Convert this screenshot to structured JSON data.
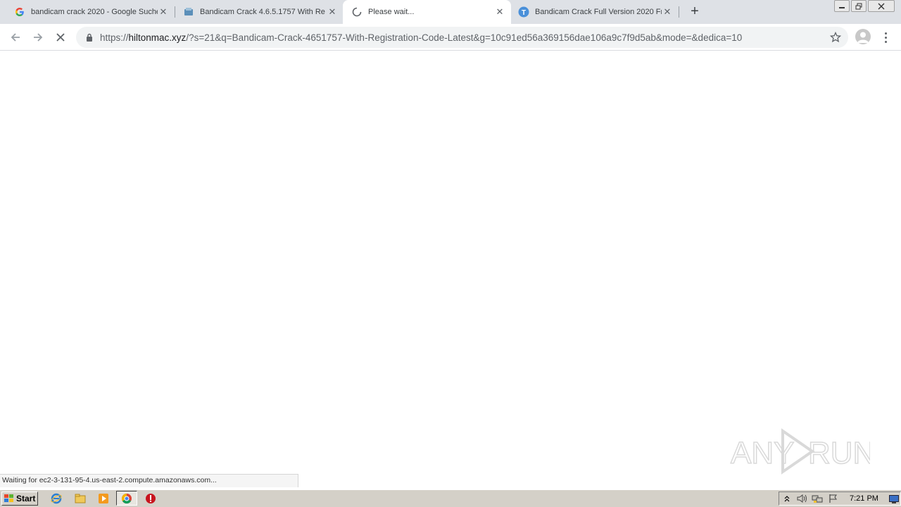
{
  "browser": {
    "tabs": [
      {
        "title": "bandicam crack 2020 - Google Suche",
        "icon": "google-icon",
        "active": false
      },
      {
        "title": "Bandicam Crack 4.6.5.1757 With Re",
        "icon": "site-icon",
        "active": false
      },
      {
        "title": "Please wait...",
        "icon": "loading-spinner-icon",
        "active": true
      },
      {
        "title": "Bandicam Crack Full Version 2020 Fr",
        "icon": "t-icon",
        "active": false
      }
    ],
    "new_tab_label": "+",
    "close_glyph": "✕",
    "url": {
      "scheme": "https://",
      "host": "hiltonmac.xyz",
      "path": "/?s=21&q=Bandicam-Crack-4651757-With-Registration-Code-Latest&g=10c91ed56a369156dae106a9c7f9d5ab&mode=&dedica=10"
    }
  },
  "status_bar": {
    "text": "Waiting for ec2-3-131-95-4.us-east-2.compute.amazonaws.com..."
  },
  "watermark": {
    "text_left": "ANY",
    "text_right": "RUN"
  },
  "taskbar": {
    "start_label": "Start",
    "clock": "7:21 PM"
  },
  "colors": {
    "tabstrip_bg": "#dee1e6",
    "omnibox_bg": "#f1f3f4",
    "taskbar_bg": "#d4d0c8"
  }
}
